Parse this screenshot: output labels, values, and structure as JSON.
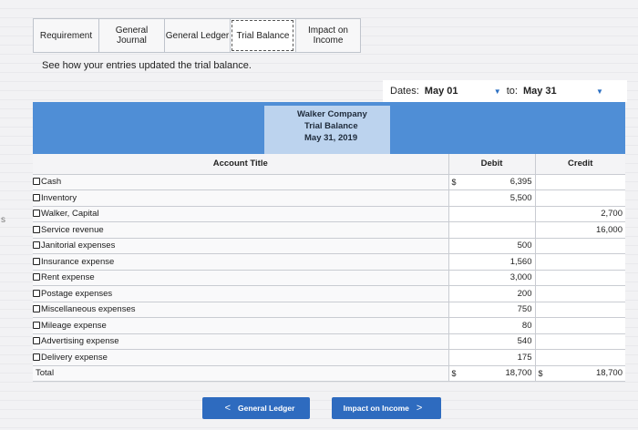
{
  "tabs": [
    {
      "label": "Requirement"
    },
    {
      "label": "General Journal"
    },
    {
      "label": "General Ledger"
    },
    {
      "label": "Trial Balance"
    },
    {
      "label": "Impact on Income"
    }
  ],
  "instruction": "See how your entries updated the trial balance.",
  "dates": {
    "label": "Dates:",
    "from": "May 01",
    "to_label": "to:",
    "to": "May 31"
  },
  "report": {
    "company": "Walker Company",
    "title": "Trial Balance",
    "date": "May 31, 2019"
  },
  "table": {
    "headers": {
      "account": "Account Title",
      "debit": "Debit",
      "credit": "Credit"
    },
    "rows": [
      {
        "account": "Cash",
        "dsign": "$",
        "debit": "6,395",
        "credit": ""
      },
      {
        "account": "Inventory",
        "dsign": "",
        "debit": "5,500",
        "credit": ""
      },
      {
        "account": "Walker, Capital",
        "dsign": "",
        "debit": "",
        "credit": "2,700"
      },
      {
        "account": "Service revenue",
        "dsign": "",
        "debit": "",
        "credit": "16,000"
      },
      {
        "account": "Janitorial expenses",
        "dsign": "",
        "debit": "500",
        "credit": ""
      },
      {
        "account": "Insurance expense",
        "dsign": "",
        "debit": "1,560",
        "credit": ""
      },
      {
        "account": "Rent expense",
        "dsign": "",
        "debit": "3,000",
        "credit": ""
      },
      {
        "account": "Postage expenses",
        "dsign": "",
        "debit": "200",
        "credit": ""
      },
      {
        "account": "Miscellaneous expenses",
        "dsign": "",
        "debit": "750",
        "credit": ""
      },
      {
        "account": "Mileage expense",
        "dsign": "",
        "debit": "80",
        "credit": ""
      },
      {
        "account": "Advertising expense",
        "dsign": "",
        "debit": "540",
        "credit": ""
      },
      {
        "account": "Delivery expense",
        "dsign": "",
        "debit": "175",
        "credit": ""
      }
    ],
    "total": {
      "label": "Total",
      "dsign": "$",
      "debit": "18,700",
      "csign": "$",
      "credit": "18,700"
    }
  },
  "nav": {
    "prev_label": "General Ledger",
    "next_label": "Impact on Income",
    "prev_chevron": "<",
    "next_chevron": ">"
  },
  "edge_text": "s"
}
